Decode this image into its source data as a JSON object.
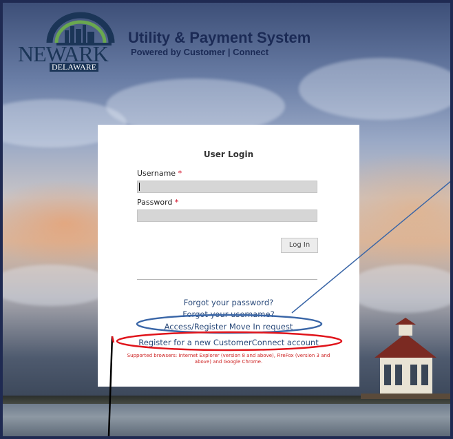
{
  "header": {
    "logo_text": "NEWARK",
    "logo_subtext": "DELAWARE",
    "title": "Utility & Payment System",
    "subtitle": "Powered by Customer | Connect"
  },
  "login": {
    "title": "User Login",
    "username_label": "Username",
    "username_value": "",
    "password_label": "Password",
    "password_value": "",
    "required_marker": "*",
    "login_button": "Log In",
    "links": {
      "forgot_password": "Forgot your password?",
      "forgot_username": "Forgot your username?",
      "move_in": "Access/Register Move In request",
      "register": "Register for a new CustomerConnect account"
    },
    "supported_browsers": "Supported browsers: Internet Explorer (version 8 and above), FireFox (version 3 and above) and Google Chrome."
  },
  "colors": {
    "frame_border": "#1f2a52",
    "annotation_blue": "#3a66a7",
    "annotation_red": "#e0141b",
    "link": "#2a4a7a",
    "required": "#d0021b"
  }
}
